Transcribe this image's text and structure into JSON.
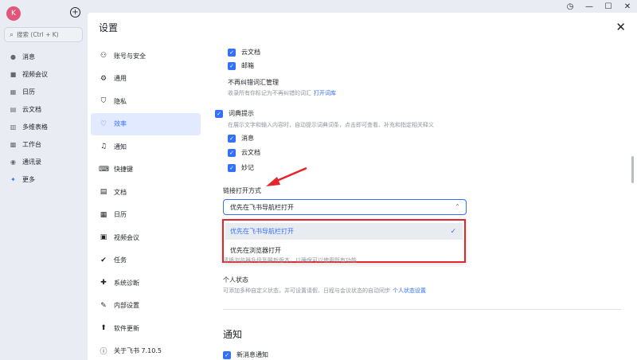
{
  "app": {
    "avatar_letter": "K",
    "search_placeholder": "搜索 (Ctrl + K)",
    "nav": [
      {
        "label": "消息",
        "icon": "chat-icon"
      },
      {
        "label": "视频会议",
        "icon": "video-icon"
      },
      {
        "label": "日历",
        "icon": "calendar-icon"
      },
      {
        "label": "云文档",
        "icon": "document-icon"
      },
      {
        "label": "多维表格",
        "icon": "table-icon"
      },
      {
        "label": "工作台",
        "icon": "grid-icon"
      },
      {
        "label": "通讯录",
        "icon": "contacts-icon"
      },
      {
        "label": "更多",
        "icon": "more-icon"
      }
    ]
  },
  "window": {
    "history": "◷",
    "minimize": "—",
    "maximize": "☐",
    "close": "✕"
  },
  "settings": {
    "title": "设置",
    "categories": [
      {
        "label": "账号与安全",
        "icon": "user-icon"
      },
      {
        "label": "通用",
        "icon": "gear-icon"
      },
      {
        "label": "隐私",
        "icon": "shield-icon"
      },
      {
        "label": "效率",
        "icon": "lightbulb-icon"
      },
      {
        "label": "通知",
        "icon": "bell-icon"
      },
      {
        "label": "快捷键",
        "icon": "keyboard-icon"
      },
      {
        "label": "文档",
        "icon": "doc-icon"
      },
      {
        "label": "日历",
        "icon": "calendar-icon"
      },
      {
        "label": "视频会议",
        "icon": "video-icon"
      },
      {
        "label": "任务",
        "icon": "task-icon"
      },
      {
        "label": "系统诊断",
        "icon": "diagnose-icon"
      },
      {
        "label": "内部设置",
        "icon": "wrench-icon"
      },
      {
        "label": "软件更新",
        "icon": "update-icon"
      },
      {
        "label": "关于飞书 7.10.5",
        "icon": "info-icon"
      }
    ],
    "active_category": "效率",
    "content": {
      "cb_yun": "云文档",
      "cb_mail": "邮箱",
      "no_correct_title": "不再纠错词汇管理",
      "no_correct_hint": "收录所有你标记为不再纠错的词汇",
      "no_correct_link": "打开词库",
      "dict_label": "词典提示",
      "dict_hint": "在展示文字和输入内容时，自动提示词典词条，点击即可查看、补充和指定相关释义",
      "dict_sub": [
        "消息",
        "云文档",
        "妙记"
      ],
      "link_open_title": "链接打开方式",
      "link_open_value": "优先在飞书导航栏打开",
      "options": [
        "优先在飞书导航栏打开",
        "优先在浏览器打开"
      ],
      "browser_hint": "请将浏览器升级到最新版本，以确保可以使用所有功能",
      "status_title": "个人状态",
      "status_hint": "可添加多种自定义状态，并可设置请假、日程与会议状态的自动同步",
      "status_link": "个人状态设置",
      "notify_section": "通知",
      "notify_new": "新消息通知"
    }
  }
}
